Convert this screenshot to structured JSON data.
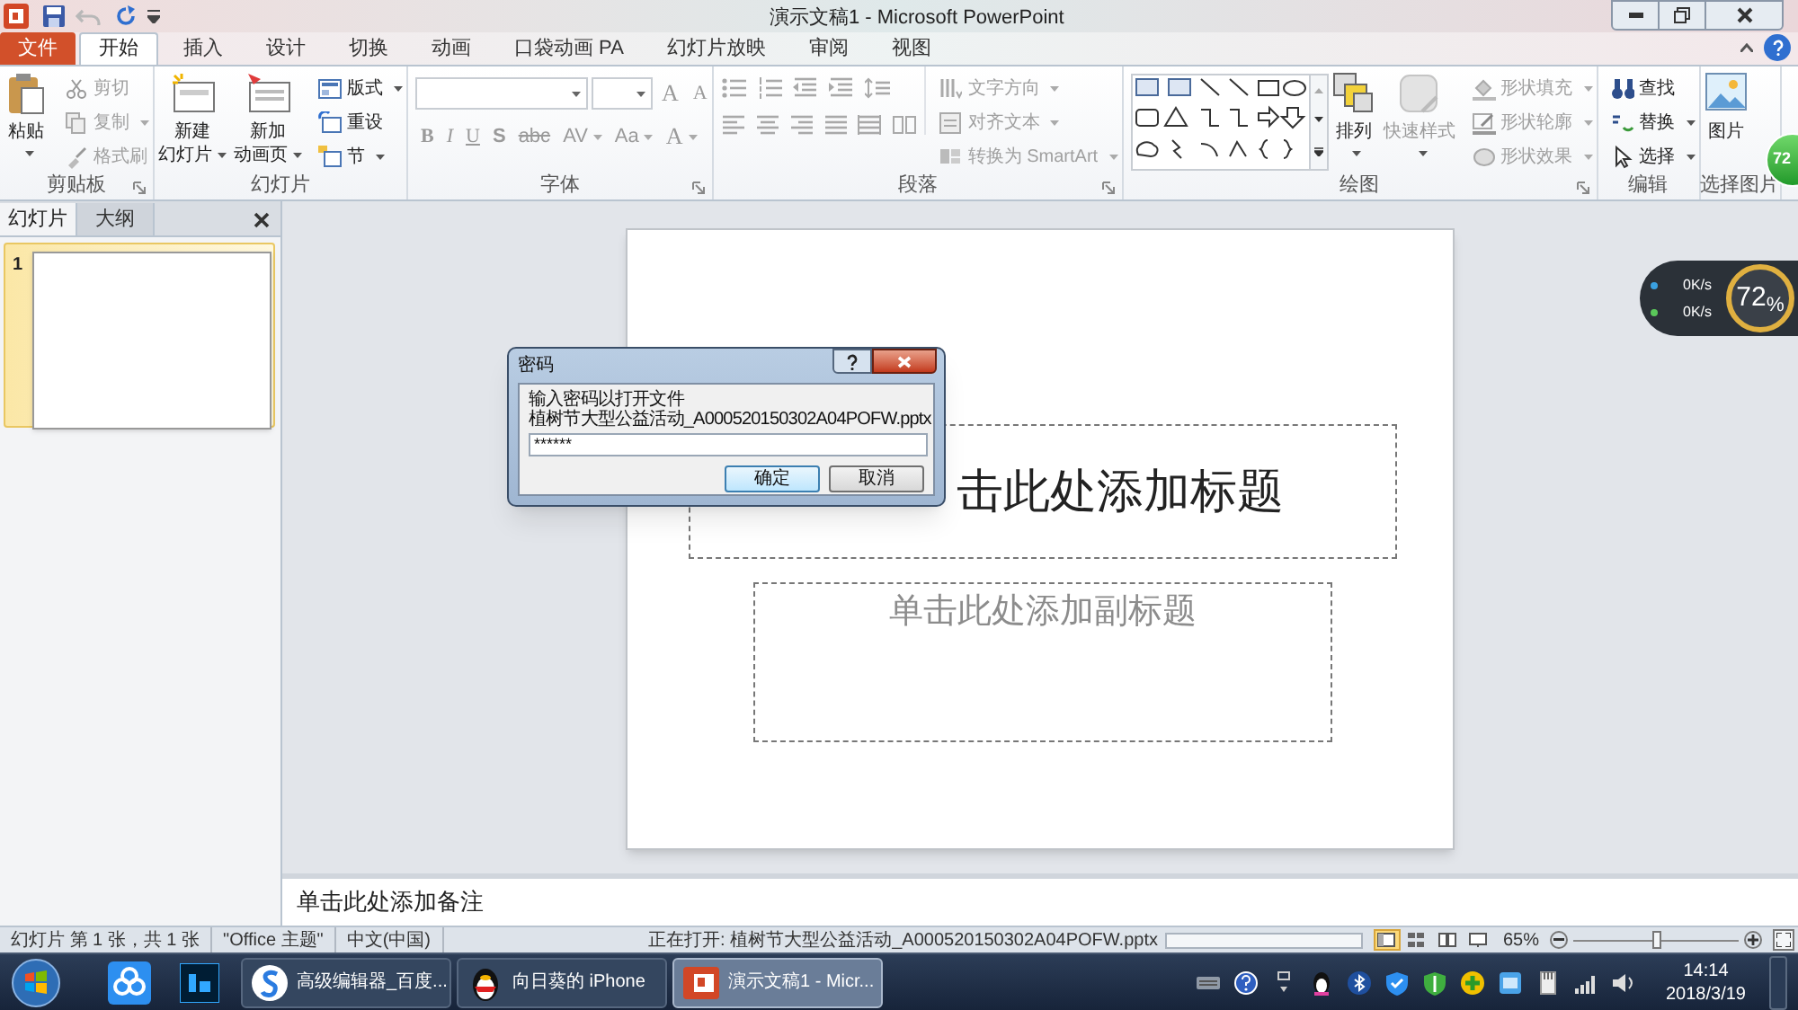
{
  "title_bar": {
    "title": "演示文稿1 - Microsoft PowerPoint",
    "undo_disabled": true
  },
  "tabs": [
    {
      "label": "文件",
      "kind": "file",
      "selected": false
    },
    {
      "label": "开始",
      "kind": "tab",
      "selected": true
    },
    {
      "label": "插入",
      "kind": "tab",
      "selected": false
    },
    {
      "label": "设计",
      "kind": "tab",
      "selected": false
    },
    {
      "label": "切换",
      "kind": "tab",
      "selected": false
    },
    {
      "label": "动画",
      "kind": "tab",
      "selected": false
    },
    {
      "label": "口袋动画 PA",
      "kind": "tab",
      "selected": false
    },
    {
      "label": "幻灯片放映",
      "kind": "tab",
      "selected": false
    },
    {
      "label": "审阅",
      "kind": "tab",
      "selected": false
    },
    {
      "label": "视图",
      "kind": "tab",
      "selected": false
    }
  ],
  "ribbon": {
    "groups": [
      {
        "kind": "clipboard",
        "label": "剪贴板",
        "launcher": true,
        "large": [
          {
            "lines": [
              "粘贴"
            ],
            "dropdown": true,
            "disabled": false
          }
        ],
        "small": [
          {
            "label": "剪切",
            "dropdown": false,
            "disabled": true
          },
          {
            "label": "复制",
            "dropdown": true,
            "disabled": true
          },
          {
            "label": "格式刷",
            "dropdown": false,
            "disabled": true
          }
        ]
      },
      {
        "kind": "slides",
        "label": "幻灯片",
        "launcher": false,
        "large": [
          {
            "lines": [
              "新建",
              "幻灯片"
            ],
            "dropdown": true,
            "disabled": false
          },
          {
            "lines": [
              "新加",
              "动画页"
            ],
            "dropdown": true,
            "disabled": false
          }
        ],
        "small": [
          {
            "label": "版式",
            "dropdown": true,
            "disabled": false
          },
          {
            "label": "重设",
            "dropdown": false,
            "disabled": false
          },
          {
            "label": "节",
            "dropdown": true,
            "disabled": false
          }
        ]
      },
      {
        "kind": "font",
        "label": "字体",
        "launcher": true,
        "disabled": true,
        "size_glyphs": [
          {
            "text": "A",
            "dropdown": false
          },
          {
            "text": "A",
            "dropdown": false
          }
        ],
        "format_glyphs": [
          {
            "text": "B",
            "dropdown": false
          },
          {
            "text": "I",
            "dropdown": false
          },
          {
            "text": "U",
            "dropdown": false
          },
          {
            "text": "S",
            "dropdown": false
          },
          {
            "text": "abc",
            "dropdown": false
          },
          {
            "text": "AV",
            "dropdown": true
          },
          {
            "text": "Aa",
            "dropdown": true
          },
          {
            "text": "A",
            "dropdown": true
          }
        ]
      },
      {
        "kind": "paragraph",
        "label": "段落",
        "launcher": true,
        "disabled": true,
        "small": [
          {
            "label": "文字方向",
            "dropdown": true,
            "disabled": true
          },
          {
            "label": "对齐文本",
            "dropdown": true,
            "disabled": true
          },
          {
            "label": "转换为 SmartArt",
            "dropdown": true,
            "disabled": true
          }
        ]
      },
      {
        "kind": "drawing",
        "label": "绘图",
        "launcher": true,
        "large": [
          {
            "lines": [
              "排列"
            ],
            "dropdown": true,
            "disabled": false
          },
          {
            "lines": [
              "快速样式"
            ],
            "dropdown": true,
            "disabled": true
          }
        ],
        "small": [
          {
            "label": "形状填充",
            "dropdown": true,
            "disabled": true
          },
          {
            "label": "形状轮廓",
            "dropdown": true,
            "disabled": true
          },
          {
            "label": "形状效果",
            "dropdown": true,
            "disabled": true
          }
        ]
      },
      {
        "kind": "editing",
        "label": "编辑",
        "launcher": false,
        "small": [
          {
            "label": "查找",
            "dropdown": false,
            "disabled": false
          },
          {
            "label": "替换",
            "dropdown": true,
            "disabled": false
          },
          {
            "label": "选择",
            "dropdown": true,
            "disabled": false
          }
        ]
      },
      {
        "kind": "picture",
        "label": "选择图片",
        "launcher": false,
        "large": [
          {
            "lines": [
              "图片"
            ],
            "dropdown": false,
            "disabled": false
          }
        ]
      }
    ]
  },
  "slide_panel": {
    "tabs": [
      {
        "label": "幻灯片",
        "selected": true
      },
      {
        "label": "大纲",
        "selected": false
      }
    ],
    "thumbnails": [
      {
        "number": "1",
        "selected": true
      }
    ]
  },
  "slide": {
    "title_placeholder": "击此处添加标题",
    "subtitle_placeholder": "单击此处添加副标题"
  },
  "notes": {
    "placeholder": "单击此处添加备注"
  },
  "dialog": {
    "title": "密码",
    "message_lines": [
      "输入密码以打开文件",
      "植树节大型公益活动_A000520150302A04POFW.pptx"
    ],
    "password": "******",
    "buttons": [
      {
        "label": "确定",
        "default": true
      },
      {
        "label": "取消",
        "default": false
      }
    ]
  },
  "network_widget": {
    "upload": "0K/s",
    "download": "0K/s",
    "percent": "72$_{%}$"
  },
  "speed_ball": {
    "text": "72"
  },
  "status_bar": {
    "items": [
      "幻灯片 第 1 张，共 1 张",
      "\"Office 主题\"",
      "中文(中国)"
    ],
    "progress": {
      "label": "正在打开: 植树节大型公益活动_A000520150302A04POFW.pptx",
      "level": 0
    },
    "views": [
      {
        "selected": true
      },
      {
        "selected": false
      },
      {
        "selected": false
      },
      {
        "selected": false
      }
    ],
    "zoom": "65%",
    "zoom_slider": {
      "level": 0.5
    }
  },
  "taskbar": {
    "tasks": [
      {
        "label": "高级编辑器_百度...",
        "kind": "browser",
        "selected": false
      },
      {
        "label": "向日葵的 iPhone",
        "kind": "chat",
        "selected": false
      },
      {
        "label": "演示文稿1 - Micr...",
        "kind": "powerpoint",
        "selected": true
      }
    ],
    "clock": {
      "time": "14:14",
      "date": "2018/3/19"
    }
  }
}
